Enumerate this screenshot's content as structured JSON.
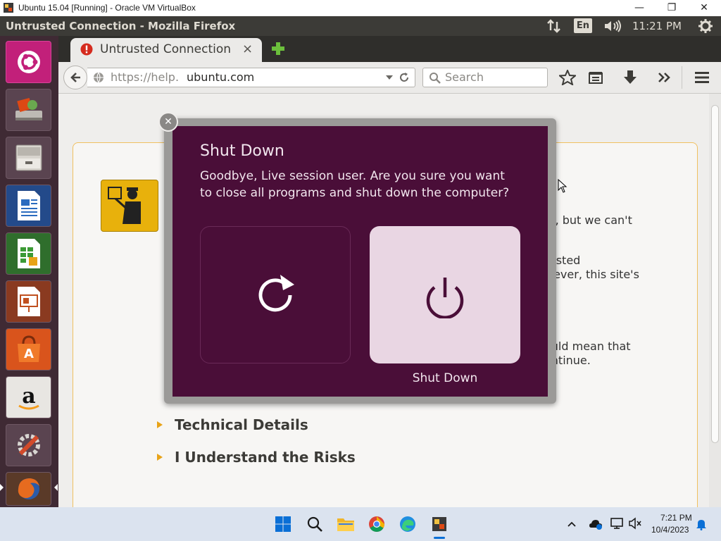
{
  "vbox": {
    "title": "Ubuntu 15.04 [Running] - Oracle VM VirtualBox",
    "minimize": "—",
    "maximize": "❐",
    "close": "✕"
  },
  "panel": {
    "window_title": "Untrusted Connection - Mozilla Firefox",
    "keyboard": "En",
    "clock": "11:21 PM"
  },
  "launcher": {
    "items": [
      "dash-home",
      "files-installer",
      "file-manager",
      "writer",
      "calc",
      "impress",
      "software-center",
      "amazon",
      "system-settings",
      "firefox"
    ]
  },
  "firefox": {
    "tab_title": "Untrusted Connection",
    "tab_close": "×",
    "new_tab": "+",
    "url_prefix": "https://help.",
    "url_domain": "ubuntu.com",
    "search_placeholder": "Search"
  },
  "page": {
    "para1_tail": "m, but we can't",
    "para2_tail_a": "rusted",
    "para2_tail_b": "wever, this site's",
    "para3_tail_a": "ould mean that",
    "para3_tail_b": "ontinue.",
    "technical_details": "Technical Details",
    "understand_risks": "I Understand the Risks"
  },
  "dialog": {
    "title": "Shut Down",
    "message": "Goodbye, Live session user. Are you sure you want to close all programs and shut down the computer?",
    "shutdown_label": "Shut Down",
    "close_glyph": "✕"
  },
  "taskbar": {
    "time": "7:21 PM",
    "date": "10/4/2023"
  },
  "colors": {
    "dialog_bg": "#4a0e38",
    "ubuntu_orange": "#dd4814",
    "panel_bg": "#3c3b37",
    "warning_yellow": "#e8b10c"
  }
}
